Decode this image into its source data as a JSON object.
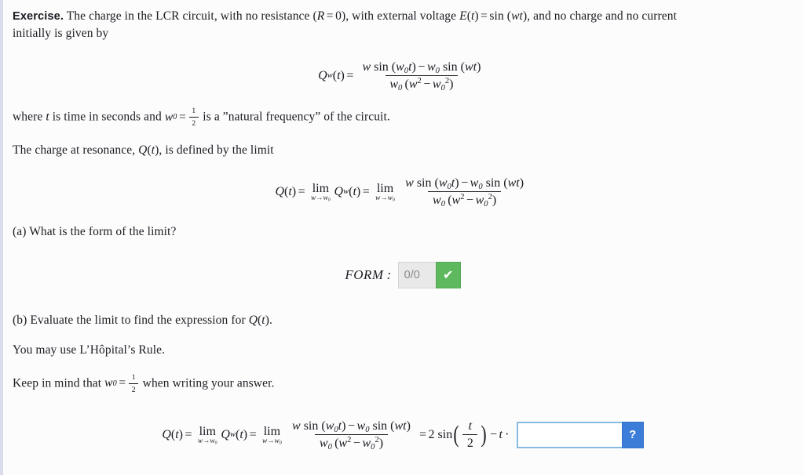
{
  "document": {
    "label_exercise": "Exercise.",
    "intro_line1": "The charge in the LCR circuit, with no resistance (R = 0), with external voltage E(t) = sin (wt), and no charge and no current",
    "intro_line2": "initially is given by",
    "where_line": "where t is time in seconds and w₀ = 1/2 is a ”natural frequency” of the circuit.",
    "resonance_line": "The charge at resonance, Q(t), is defined by the limit",
    "part_a": "(a) What is the form of the limit?",
    "part_b": "(b) Evaluate the limit to find the expression for Q(t).",
    "hint_hopital": "You may use L’Hôpital’s Rule.",
    "hint_w0": "Keep in mind that w₀ = 1/2 when writing your answer."
  },
  "text_tokens": {
    "the_charge_in_the": "The charge in the LCR circuit, with no resistance (",
    "R": "R",
    "eq": "=",
    "zero": "0",
    "with_external_voltage": "), with external voltage ",
    "E": "E",
    "t": "t",
    "sin": "sin",
    "w": "w",
    "and_no_charge": ", and no charge and no current",
    "initially": "initially is given by",
    "where": "where ",
    "is_time_in_seconds_and": " is time in seconds and ",
    "is_a_natural_freq": " is a ”natural frequency” of the circuit.",
    "the_charge_at_resonance": "The charge at resonance, ",
    "is_defined_by_the_limit": ", is defined by the limit",
    "part_a_text": "(a) What is the form of the limit?",
    "part_b_prefix": "(b) Evaluate the limit to find the expression for ",
    "part_b_suffix": ".",
    "hopital": "You may use L’Hôpital’s Rule.",
    "keep_in_mind_prefix": "Keep in mind that ",
    "keep_in_mind_suffix": " when writing your answer.",
    "Q": "Q",
    "lim": "lim",
    "arrow": "→",
    "minus": "−",
    "one": "1",
    "two": "2",
    "cdot": "·",
    "lparen": "(",
    "rparen": ")",
    "colon": ":"
  },
  "equations": {
    "eq1": {
      "lhs": "Q_w(t) =",
      "numerator": "w sin (w₀t) − w₀ sin (wt)",
      "denominator": "w₀(w² − w₀²)"
    },
    "eq2": {
      "lhs": "Q(t) = lim_{w→w₀} Q_w(t) = lim_{w→w₀}",
      "numerator": "w sin (w₀t) − w₀ sin (wt)",
      "denominator": "w₀(w² − w₀²)"
    },
    "eq3": {
      "lhs": "Q(t) = lim_{w→w₀} Q_w(t) = lim_{w→w₀}",
      "numerator": "w sin (w₀t) − w₀ sin (wt)",
      "denominator": "w₀(w² − w₀²)",
      "result_prefix": "= 2 sin (t/2) − t ·"
    }
  },
  "form_answer": {
    "label": "FORM",
    "value": "0/0",
    "placeholder": "",
    "submit_icon": "✔",
    "submit_color": "#5eb85e"
  },
  "final_answer": {
    "value": "",
    "placeholder": "",
    "help_label": "?",
    "help_color": "#3b7dd8",
    "border_color": "#86bbe4"
  },
  "colors": {
    "page_background": "#fcfcfd",
    "left_strip": "#d9dceb",
    "text": "#1c1c22",
    "input_gray": "#e9e9e9",
    "gray_text": "#8a8a8a"
  }
}
